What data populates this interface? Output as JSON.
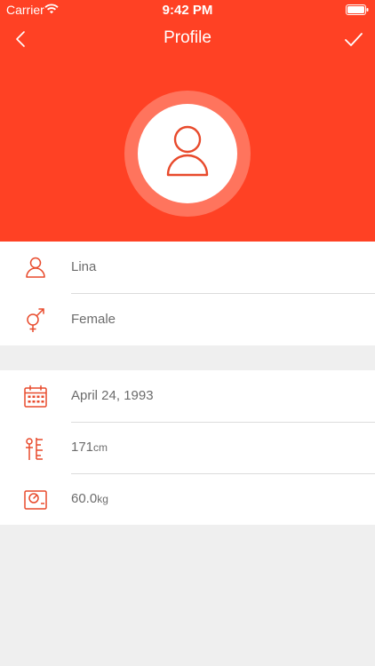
{
  "status_bar": {
    "carrier": "Carrier",
    "time": "9:42 PM"
  },
  "nav": {
    "title": "Profile",
    "back_icon": "chevron-left-icon",
    "done_icon": "checkmark-icon"
  },
  "avatar": {
    "icon": "person-icon"
  },
  "colors": {
    "accent": "#ff4124",
    "avatar_ring": "#ff745d",
    "icon_stroke": "#e84a2c",
    "text_secondary": "#6c6c6c",
    "background": "#efefef"
  },
  "profile": {
    "name": "Lina",
    "gender": "Female",
    "birthday": "April 24, 1993",
    "height": {
      "value": "171",
      "unit": "cm"
    },
    "weight": {
      "value": "60.0",
      "unit": "kg"
    }
  }
}
